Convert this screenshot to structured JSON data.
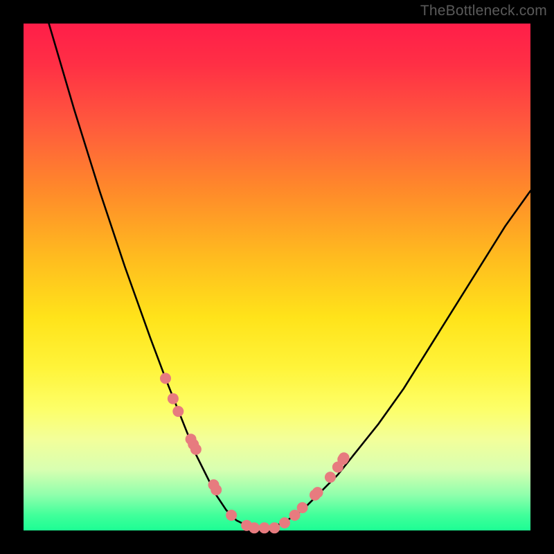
{
  "watermark": "TheBottleneck.com",
  "colors": {
    "frame": "#000000",
    "curve": "#000000",
    "marker": "#e77b7f",
    "gradient_top": "#ff1e49",
    "gradient_mid": "#ffe31a",
    "gradient_bottom": "#1dfd94"
  },
  "chart_data": {
    "type": "line",
    "title": "",
    "xlabel": "",
    "ylabel": "",
    "xlim": [
      0,
      100
    ],
    "ylim": [
      0,
      100
    ],
    "grid": false,
    "series": [
      {
        "name": "bottleneck-curve",
        "x": [
          5,
          10,
          15,
          20,
          25,
          28,
          30,
          32,
          34,
          36,
          38,
          40,
          42,
          44,
          46,
          48,
          50,
          52,
          55,
          58,
          62,
          66,
          70,
          75,
          80,
          85,
          90,
          95,
          100
        ],
        "y": [
          100,
          83,
          67,
          52,
          38,
          30,
          25,
          20,
          15,
          11,
          7,
          4,
          2,
          1,
          0.5,
          0.5,
          1,
          2,
          4,
          7,
          11,
          16,
          21,
          28,
          36,
          44,
          52,
          60,
          67
        ]
      }
    ],
    "markers": {
      "name": "highlighted-points",
      "x": [
        28.0,
        29.5,
        30.5,
        33.0,
        33.5,
        34.0,
        37.5,
        38.0,
        41.0,
        44.0,
        45.5,
        47.5,
        49.5,
        51.5,
        53.5,
        55.0,
        57.5,
        58.0,
        60.5,
        62.0,
        63.0,
        63.2
      ],
      "y": [
        30.0,
        26.0,
        23.5,
        18.0,
        17.0,
        16.0,
        9.0,
        8.0,
        3.0,
        1.0,
        0.5,
        0.5,
        0.5,
        1.5,
        3.0,
        4.5,
        7.0,
        7.5,
        10.5,
        12.5,
        14.0,
        14.3
      ]
    }
  }
}
